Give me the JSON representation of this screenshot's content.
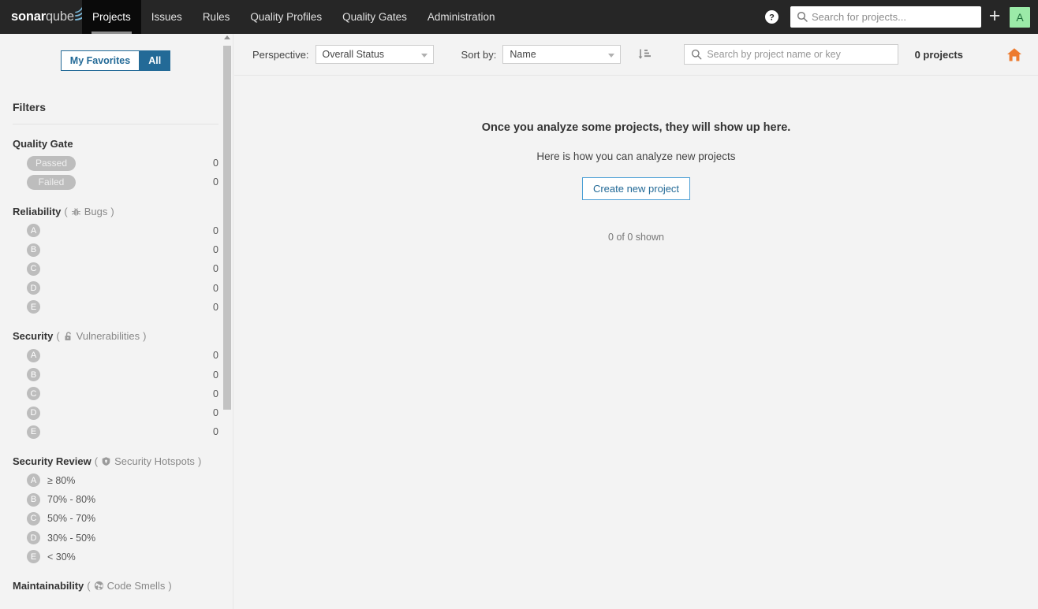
{
  "header": {
    "logo_bold": "sonar",
    "logo_light": "qube",
    "nav": [
      {
        "label": "Projects",
        "active": true
      },
      {
        "label": "Issues",
        "active": false
      },
      {
        "label": "Rules",
        "active": false
      },
      {
        "label": "Quality Profiles",
        "active": false
      },
      {
        "label": "Quality Gates",
        "active": false
      },
      {
        "label": "Administration",
        "active": false
      }
    ],
    "help_icon": "help-circle-icon",
    "search_placeholder": "Search for projects...",
    "search_value": "",
    "plus_label": "+",
    "avatar_initial": "A",
    "avatar_color": "#9beaa8"
  },
  "sidebar": {
    "favorites_toggle": [
      {
        "label": "My Favorites",
        "active": false
      },
      {
        "label": "All",
        "active": true
      }
    ],
    "filters_title": "Filters",
    "facets": [
      {
        "title": "Quality Gate",
        "icon": "",
        "sub": "",
        "type": "pill",
        "rows": [
          {
            "label": "Passed",
            "count": "0"
          },
          {
            "label": "Failed",
            "count": "0"
          }
        ]
      },
      {
        "title": "Reliability",
        "icon": "bug-icon",
        "sub": "Bugs",
        "type": "rating",
        "rows": [
          {
            "label": "A",
            "count": "0"
          },
          {
            "label": "B",
            "count": "0"
          },
          {
            "label": "C",
            "count": "0"
          },
          {
            "label": "D",
            "count": "0"
          },
          {
            "label": "E",
            "count": "0"
          }
        ]
      },
      {
        "title": "Security",
        "icon": "vulnerability-lock-icon",
        "sub": "Vulnerabilities",
        "type": "rating",
        "rows": [
          {
            "label": "A",
            "count": "0"
          },
          {
            "label": "B",
            "count": "0"
          },
          {
            "label": "C",
            "count": "0"
          },
          {
            "label": "D",
            "count": "0"
          },
          {
            "label": "E",
            "count": "0"
          }
        ]
      },
      {
        "title": "Security Review",
        "icon": "security-hotspot-shield-icon",
        "sub": "Security Hotspots",
        "type": "range",
        "rows": [
          {
            "label": "A",
            "range": "≥ 80%"
          },
          {
            "label": "B",
            "range": "70% - 80%"
          },
          {
            "label": "C",
            "range": "50% - 70%"
          },
          {
            "label": "D",
            "range": "30% - 50%"
          },
          {
            "label": "E",
            "range": "< 30%"
          }
        ]
      },
      {
        "title": "Maintainability",
        "icon": "code-smell-icon",
        "sub": "Code Smells",
        "type": "rating",
        "rows": []
      }
    ],
    "paren_open": "(",
    "paren_close": ")"
  },
  "toolbar": {
    "perspective_label": "Perspective:",
    "perspective_value": "Overall Status",
    "sort_label": "Sort by:",
    "sort_value": "Name",
    "sort_direction_icon": "sort-descending-icon",
    "search_placeholder": "Search by project name or key",
    "search_value": "",
    "projects_count": "0 projects",
    "home_icon": "home-icon",
    "home_color": "#ed7b2f"
  },
  "main": {
    "empty_title": "Once you analyze some projects, they will show up here.",
    "empty_subtitle": "Here is how you can analyze new projects",
    "create_button": "Create new project",
    "shown_text": "0 of 0 shown"
  }
}
